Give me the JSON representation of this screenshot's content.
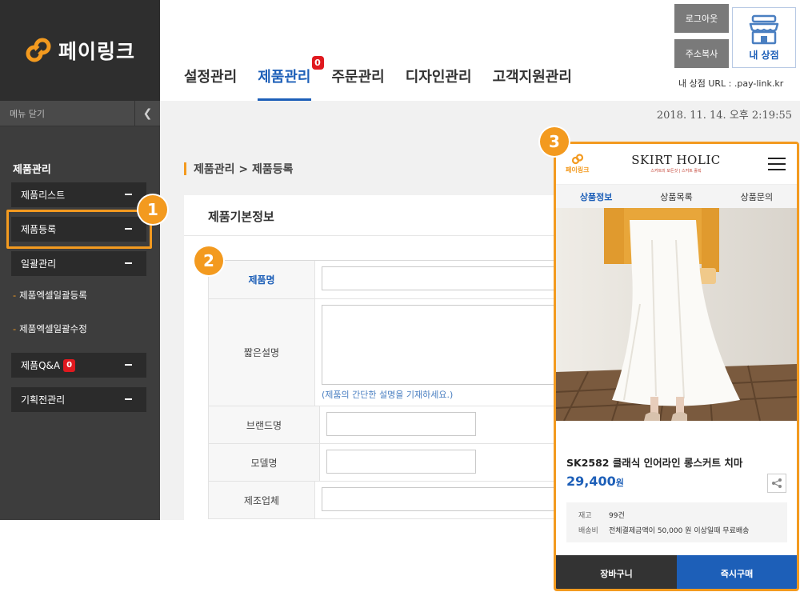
{
  "sidebar": {
    "brand_name": "페이링크",
    "menu_toggle": "메뉴 닫기",
    "section_title": "제품관리",
    "items": {
      "product_list": "제품리스트",
      "product_register": "제품등록",
      "bulk_manage": "일괄관리",
      "excel_bulk_register": "제품엑셀일괄등록",
      "excel_bulk_edit": "제품엑셀일괄수정",
      "qa": "제품Q&A",
      "qa_badge": "0",
      "exhibition": "기획전관리"
    }
  },
  "header": {
    "tabs": [
      "설정관리",
      "제품관리",
      "주문관리",
      "디자인관리",
      "고객지원관리"
    ],
    "active_tab": "제품관리",
    "product_tab_badge": "0",
    "logout": "로그아웃",
    "copy_address": "주소복사",
    "my_store": "내 상점",
    "store_url": "내 상점 URL : .pay-link.kr"
  },
  "main": {
    "datetime": "2018. 11. 14. 오후 2:19:55",
    "breadcrumb": "제품관리 > 제품등록",
    "panel_title": "제품기본정보",
    "form": {
      "product_name_label": "제품명",
      "short_desc_label": "짧은설명",
      "short_desc_hint": "(제품의 간단한 설명을 기재하세요.)",
      "brand_label": "브랜드명",
      "model_label": "모델명",
      "maker_label": "제조업체"
    }
  },
  "mobile_preview": {
    "logo_text": "페이링크",
    "shop_name": "SKIRT HOLIC",
    "shop_sub": "스커트의 모든것 | 스커트 홀릭",
    "tabs": [
      "상품정보",
      "상품목록",
      "상품문의"
    ],
    "product_title": "SK2582 클래식 인어라인 롱스커트 치마",
    "price": "29,400",
    "price_unit": "원",
    "stock_label": "재고",
    "stock_value": "99건",
    "shipping_label": "배송비",
    "shipping_value": "전체결제금액이 50,000 원 이상일때 무료배송",
    "cart_button": "장바구니",
    "buy_button": "즉시구매"
  },
  "steps": [
    "1",
    "2",
    "3"
  ],
  "colors": {
    "accent_orange": "#f39a1f",
    "brand_blue": "#1d5fb8",
    "sidebar_dark": "#3d3d3d",
    "badge_red": "#e0191f"
  }
}
